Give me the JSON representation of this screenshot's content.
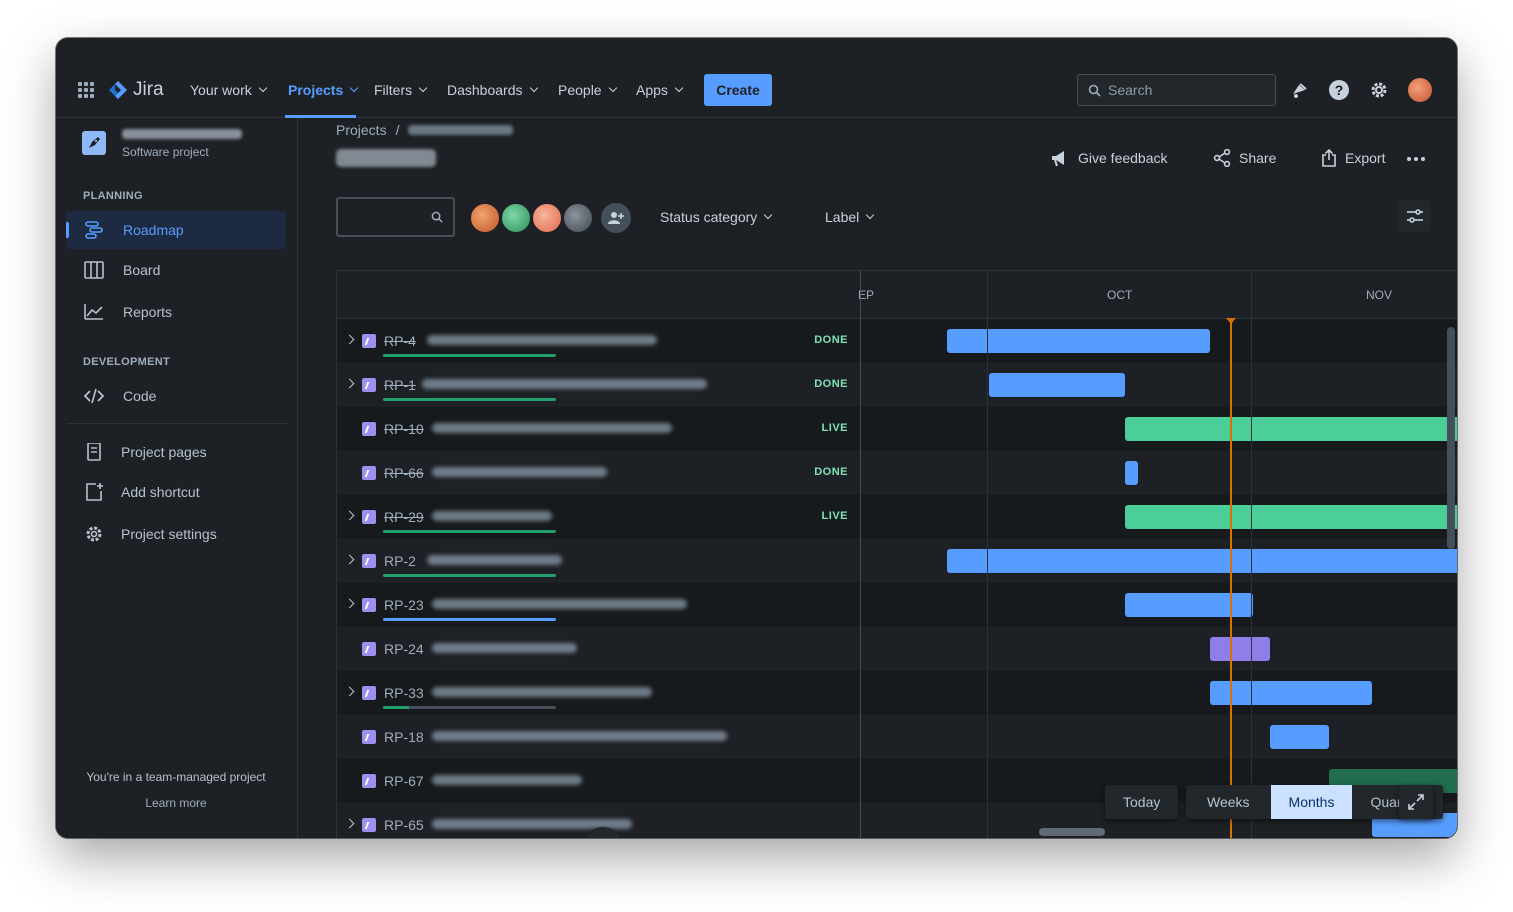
{
  "app": {
    "name": "Jira"
  },
  "nav": {
    "your_work": "Your work",
    "projects": "Projects",
    "filters": "Filters",
    "dashboards": "Dashboards",
    "people": "People",
    "apps": "Apps",
    "create": "Create",
    "search_placeholder": "Search"
  },
  "sidebar": {
    "project_type": "Software project",
    "planning_heading": "PLANNING",
    "items": [
      {
        "label": "Roadmap",
        "icon": "roadmap-icon"
      },
      {
        "label": "Board",
        "icon": "board-icon"
      },
      {
        "label": "Reports",
        "icon": "reports-icon"
      }
    ],
    "development_heading": "DEVELOPMENT",
    "code": "Code",
    "project_pages": "Project pages",
    "add_shortcut": "Add shortcut",
    "project_settings": "Project settings",
    "footer_text": "You're in a team-managed project",
    "learn_more": "Learn more"
  },
  "breadcrumb": {
    "root": "Projects",
    "separator": "/"
  },
  "actions": {
    "give_feedback": "Give feedback",
    "share": "Share",
    "export": "Export"
  },
  "filters": {
    "status_category": "Status category",
    "label": "Label"
  },
  "timeline": {
    "months": [
      "EP",
      "OCT",
      "NOV"
    ],
    "today_color": "#d97008"
  },
  "rows": [
    {
      "key": "RP-4",
      "done": true,
      "status": "DONE",
      "expandable": true,
      "progress": 1.0,
      "progress_color": "#22a06b",
      "bar_color": "#579dff"
    },
    {
      "key": "RP-1",
      "done": true,
      "status": "DONE",
      "expandable": true,
      "progress": 1.0,
      "progress_color": "#22a06b",
      "bar_color": "#579dff"
    },
    {
      "key": "RP-10",
      "done": true,
      "status": "LIVE",
      "expandable": false,
      "progress": null,
      "bar_color": "#4bce97"
    },
    {
      "key": "RP-66",
      "done": true,
      "status": "DONE",
      "expandable": false,
      "progress": null,
      "bar_color": "#579dff"
    },
    {
      "key": "RP-29",
      "done": true,
      "status": "LIVE",
      "expandable": true,
      "progress": 1.0,
      "progress_color": "#22a06b",
      "bar_color": "#4bce97"
    },
    {
      "key": "RP-2",
      "done": false,
      "status": "",
      "expandable": true,
      "progress": 1.0,
      "progress_color": "#22a06b",
      "bar_color": "#579dff"
    },
    {
      "key": "RP-23",
      "done": false,
      "status": "",
      "expandable": true,
      "progress": 1.0,
      "progress_color": "#579dff",
      "bar_color": "#579dff"
    },
    {
      "key": "RP-24",
      "done": false,
      "status": "",
      "expandable": false,
      "progress": null,
      "bar_color": "#8f7ee7"
    },
    {
      "key": "RP-33",
      "done": false,
      "status": "",
      "expandable": true,
      "progress": 0.15,
      "progress_color": "#22a06b",
      "bar_color": "#579dff"
    },
    {
      "key": "RP-18",
      "done": false,
      "status": "",
      "expandable": false,
      "progress": null,
      "bar_color": "#579dff"
    },
    {
      "key": "RP-67",
      "done": false,
      "status": "",
      "expandable": false,
      "progress": null,
      "bar_color": "#216e4e"
    },
    {
      "key": "RP-65",
      "done": false,
      "status": "",
      "expandable": true,
      "progress": null,
      "bar_color": "#579dff"
    }
  ],
  "zoom": {
    "today": "Today",
    "weeks": "Weeks",
    "months": "Months",
    "quarters": "Quarters",
    "selected": "Months"
  },
  "colors": {
    "accent": "#579dff",
    "background": "#1d2125",
    "done_lozenge": "#7ee2b8"
  }
}
